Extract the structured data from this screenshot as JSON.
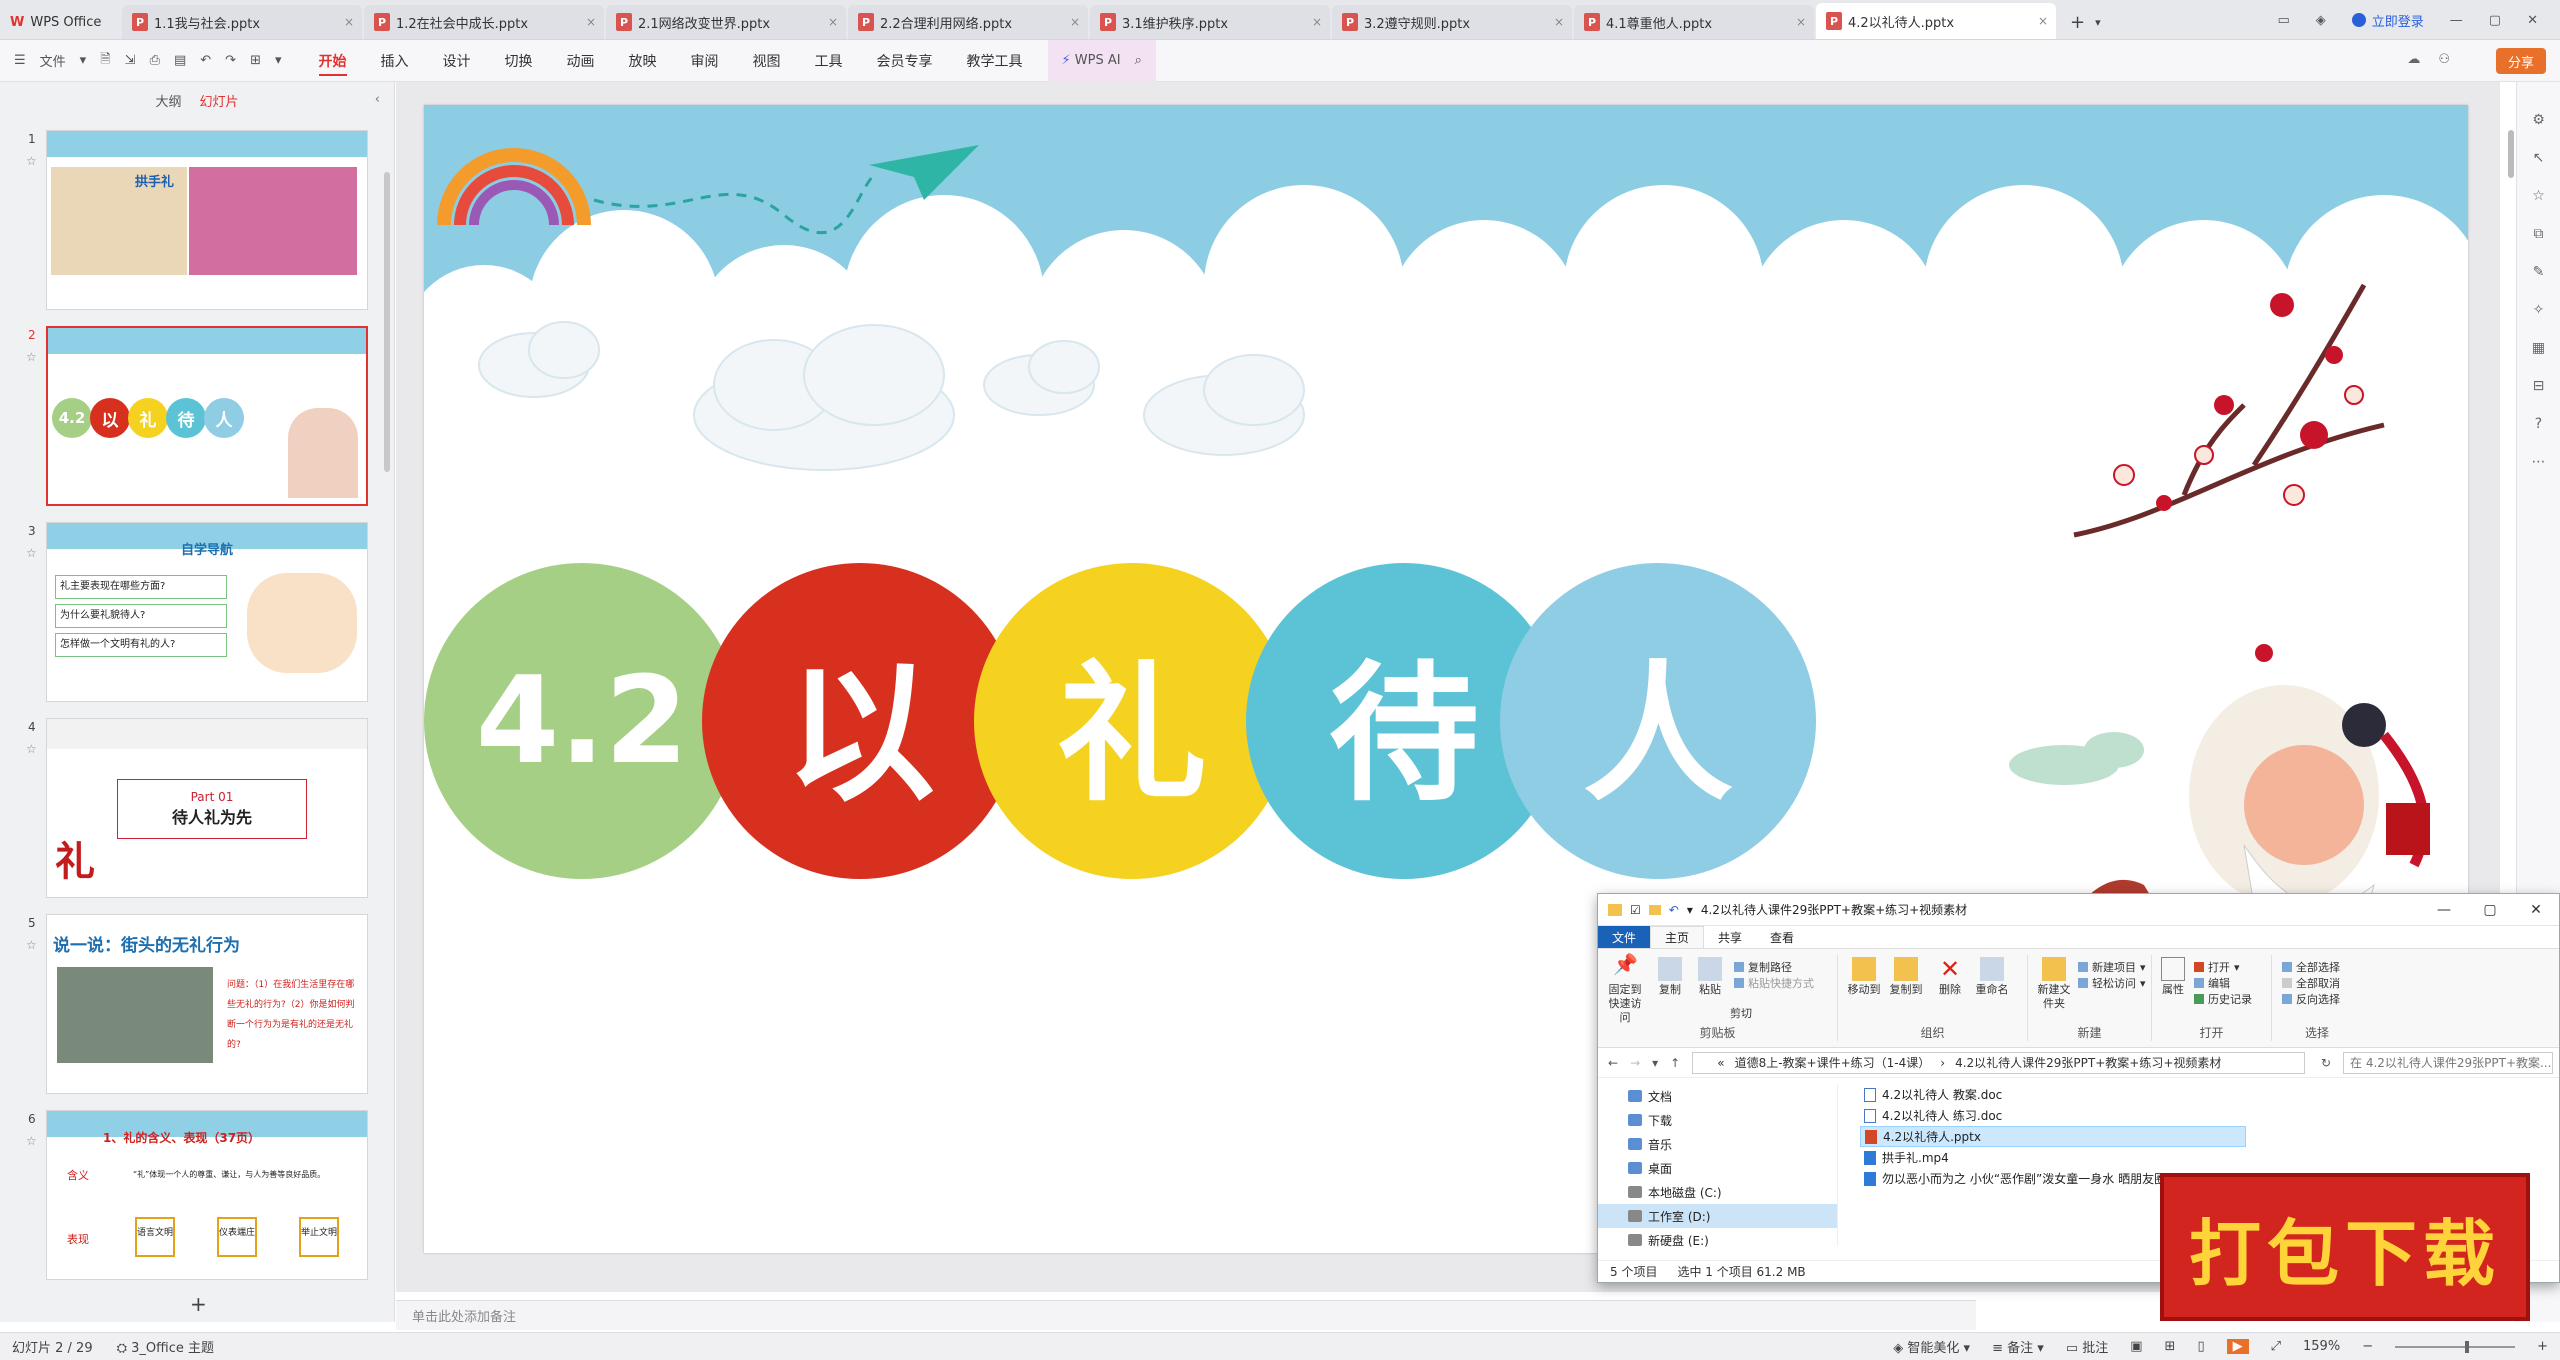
{
  "tabs": [
    {
      "label": "WPS Office",
      "kind": "home"
    },
    {
      "label": "1.1我与社会.pptx"
    },
    {
      "label": "1.2在社会中成长.pptx"
    },
    {
      "label": "2.1网络改变世界.pptx"
    },
    {
      "label": "2.2合理利用网络.pptx"
    },
    {
      "label": "3.1维护秩序.pptx"
    },
    {
      "label": "3.2遵守规则.pptx"
    },
    {
      "label": "4.1尊重他人.pptx"
    },
    {
      "label": "4.2以礼待人.pptx",
      "active": true
    }
  ],
  "account": {
    "login": "立即登录"
  },
  "toolbar": {
    "file_label": "文件",
    "menus": [
      "开始",
      "插入",
      "设计",
      "切换",
      "动画",
      "放映",
      "审阅",
      "视图",
      "工具",
      "会员专享",
      "教学工具"
    ],
    "active_menu": "开始",
    "wps_ai": "WPS AI",
    "share": "分享"
  },
  "panel": {
    "outline_tab": "大纲",
    "slides_tab": "幻灯片"
  },
  "slides": [
    {
      "num": "1",
      "title": "拱手礼"
    },
    {
      "num": "2",
      "title": "4.2 以礼待人"
    },
    {
      "num": "3",
      "title": "自学导航",
      "items": [
        "礼主要表现在哪些方面?",
        "为什么要礼貌待人?",
        "怎样做一个文明有礼的人?"
      ]
    },
    {
      "num": "4",
      "title": "Part 01",
      "subtitle": "待人礼为先"
    },
    {
      "num": "5",
      "title": "说一说：街头的无礼行为",
      "question": "问题：（1）在我们生活里存在哪些无礼的行为?（2）你是如何判断一个行为为是有礼的还是无礼的?"
    },
    {
      "num": "6",
      "title": "1、礼的含义、表现（37页）",
      "row1": "含义",
      "row1_text": "“礼”体现一个人的尊重、谦让，与人为善等良好品质。",
      "row2": "表现",
      "boxes": [
        "语言文明",
        "仪表端庄",
        "举止文明"
      ]
    }
  ],
  "main_slide": {
    "circles": [
      {
        "text": "4.2",
        "color": "#a5cf85"
      },
      {
        "text": "以",
        "color": "#d8301f"
      },
      {
        "text": "礼",
        "color": "#f5d120"
      },
      {
        "text": "待",
        "color": "#5bc3d5"
      },
      {
        "text": "人",
        "color": "#8fcde4"
      }
    ]
  },
  "notes_placeholder": "单击此处添加备注",
  "status": {
    "slide_count": "幻灯片 2 / 29",
    "theme": "3_Office 主题",
    "beautify": "智能美化",
    "notes": "备注",
    "comments": "批注",
    "zoom": "159%"
  },
  "explorer": {
    "title": "4.2以礼待人课件29张PPT+教案+练习+视频素材",
    "tabs": [
      "文件",
      "主页",
      "共享",
      "查看"
    ],
    "groups": {
      "clipboard": {
        "label": "剪贴板",
        "pin": "固定到快速访问",
        "copy": "复制",
        "paste": "粘贴",
        "copy_path": "复制路径",
        "paste_shortcut": "粘贴快捷方式",
        "cut": "剪切"
      },
      "organize": {
        "label": "组织",
        "move_to": "移动到",
        "copy_to": "复制到",
        "delete": "删除",
        "rename": "重命名"
      },
      "new": {
        "label": "新建",
        "new_folder": "新建文件夹",
        "new_item": "新建项目",
        "easy_access": "轻松访问"
      },
      "open": {
        "label": "打开",
        "properties": "属性",
        "open": "打开",
        "edit": "编辑",
        "history": "历史记录"
      },
      "select": {
        "label": "选择",
        "all": "全部选择",
        "none": "全部取消",
        "invert": "反向选择"
      }
    },
    "address": [
      "«",
      "道德8上-教案+课件+练习（1-4课）",
      "›",
      "4.2以礼待人课件29张PPT+教案+练习+视频素材"
    ],
    "search_placeholder": "在 4.2以礼待人课件29张PPT+教案...",
    "nav": [
      "文档",
      "下载",
      "音乐",
      "桌面",
      "本地磁盘 (C:)",
      "工作室 (D:)",
      "新硬盘 (E:)"
    ],
    "nav_selected": "工作室 (D:)",
    "files": [
      {
        "name": "4.2以礼待人 教案.doc",
        "kind": "doc"
      },
      {
        "name": "4.2以礼待人 练习.doc",
        "kind": "doc"
      },
      {
        "name": "4.2以礼待人.pptx",
        "kind": "ppt",
        "selected": true
      },
      {
        "name": "拱手礼.mp4",
        "kind": "mp4"
      },
      {
        "name": "勿以恶小而为之 小伙“恶作剧”泼女童一身水 晒朋友圈...",
        "kind": "mp4"
      }
    ],
    "status": {
      "count": "5 个项目",
      "selected": "选中 1 个项目  61.2 MB"
    }
  },
  "download_badge": "打包下载"
}
